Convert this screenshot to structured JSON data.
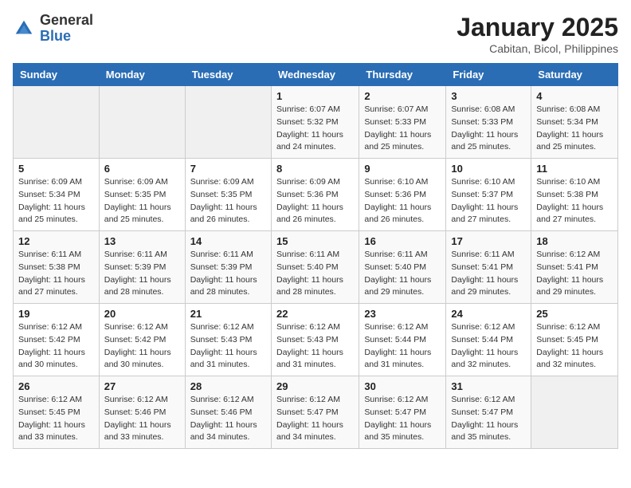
{
  "logo": {
    "general": "General",
    "blue": "Blue"
  },
  "title": "January 2025",
  "subtitle": "Cabitan, Bicol, Philippines",
  "days_of_week": [
    "Sunday",
    "Monday",
    "Tuesday",
    "Wednesday",
    "Thursday",
    "Friday",
    "Saturday"
  ],
  "weeks": [
    [
      {
        "day": "",
        "info": ""
      },
      {
        "day": "",
        "info": ""
      },
      {
        "day": "",
        "info": ""
      },
      {
        "day": "1",
        "info": "Sunrise: 6:07 AM\nSunset: 5:32 PM\nDaylight: 11 hours\nand 24 minutes."
      },
      {
        "day": "2",
        "info": "Sunrise: 6:07 AM\nSunset: 5:33 PM\nDaylight: 11 hours\nand 25 minutes."
      },
      {
        "day": "3",
        "info": "Sunrise: 6:08 AM\nSunset: 5:33 PM\nDaylight: 11 hours\nand 25 minutes."
      },
      {
        "day": "4",
        "info": "Sunrise: 6:08 AM\nSunset: 5:34 PM\nDaylight: 11 hours\nand 25 minutes."
      }
    ],
    [
      {
        "day": "5",
        "info": "Sunrise: 6:09 AM\nSunset: 5:34 PM\nDaylight: 11 hours\nand 25 minutes."
      },
      {
        "day": "6",
        "info": "Sunrise: 6:09 AM\nSunset: 5:35 PM\nDaylight: 11 hours\nand 25 minutes."
      },
      {
        "day": "7",
        "info": "Sunrise: 6:09 AM\nSunset: 5:35 PM\nDaylight: 11 hours\nand 26 minutes."
      },
      {
        "day": "8",
        "info": "Sunrise: 6:09 AM\nSunset: 5:36 PM\nDaylight: 11 hours\nand 26 minutes."
      },
      {
        "day": "9",
        "info": "Sunrise: 6:10 AM\nSunset: 5:36 PM\nDaylight: 11 hours\nand 26 minutes."
      },
      {
        "day": "10",
        "info": "Sunrise: 6:10 AM\nSunset: 5:37 PM\nDaylight: 11 hours\nand 27 minutes."
      },
      {
        "day": "11",
        "info": "Sunrise: 6:10 AM\nSunset: 5:38 PM\nDaylight: 11 hours\nand 27 minutes."
      }
    ],
    [
      {
        "day": "12",
        "info": "Sunrise: 6:11 AM\nSunset: 5:38 PM\nDaylight: 11 hours\nand 27 minutes."
      },
      {
        "day": "13",
        "info": "Sunrise: 6:11 AM\nSunset: 5:39 PM\nDaylight: 11 hours\nand 28 minutes."
      },
      {
        "day": "14",
        "info": "Sunrise: 6:11 AM\nSunset: 5:39 PM\nDaylight: 11 hours\nand 28 minutes."
      },
      {
        "day": "15",
        "info": "Sunrise: 6:11 AM\nSunset: 5:40 PM\nDaylight: 11 hours\nand 28 minutes."
      },
      {
        "day": "16",
        "info": "Sunrise: 6:11 AM\nSunset: 5:40 PM\nDaylight: 11 hours\nand 29 minutes."
      },
      {
        "day": "17",
        "info": "Sunrise: 6:11 AM\nSunset: 5:41 PM\nDaylight: 11 hours\nand 29 minutes."
      },
      {
        "day": "18",
        "info": "Sunrise: 6:12 AM\nSunset: 5:41 PM\nDaylight: 11 hours\nand 29 minutes."
      }
    ],
    [
      {
        "day": "19",
        "info": "Sunrise: 6:12 AM\nSunset: 5:42 PM\nDaylight: 11 hours\nand 30 minutes."
      },
      {
        "day": "20",
        "info": "Sunrise: 6:12 AM\nSunset: 5:42 PM\nDaylight: 11 hours\nand 30 minutes."
      },
      {
        "day": "21",
        "info": "Sunrise: 6:12 AM\nSunset: 5:43 PM\nDaylight: 11 hours\nand 31 minutes."
      },
      {
        "day": "22",
        "info": "Sunrise: 6:12 AM\nSunset: 5:43 PM\nDaylight: 11 hours\nand 31 minutes."
      },
      {
        "day": "23",
        "info": "Sunrise: 6:12 AM\nSunset: 5:44 PM\nDaylight: 11 hours\nand 31 minutes."
      },
      {
        "day": "24",
        "info": "Sunrise: 6:12 AM\nSunset: 5:44 PM\nDaylight: 11 hours\nand 32 minutes."
      },
      {
        "day": "25",
        "info": "Sunrise: 6:12 AM\nSunset: 5:45 PM\nDaylight: 11 hours\nand 32 minutes."
      }
    ],
    [
      {
        "day": "26",
        "info": "Sunrise: 6:12 AM\nSunset: 5:45 PM\nDaylight: 11 hours\nand 33 minutes."
      },
      {
        "day": "27",
        "info": "Sunrise: 6:12 AM\nSunset: 5:46 PM\nDaylight: 11 hours\nand 33 minutes."
      },
      {
        "day": "28",
        "info": "Sunrise: 6:12 AM\nSunset: 5:46 PM\nDaylight: 11 hours\nand 34 minutes."
      },
      {
        "day": "29",
        "info": "Sunrise: 6:12 AM\nSunset: 5:47 PM\nDaylight: 11 hours\nand 34 minutes."
      },
      {
        "day": "30",
        "info": "Sunrise: 6:12 AM\nSunset: 5:47 PM\nDaylight: 11 hours\nand 35 minutes."
      },
      {
        "day": "31",
        "info": "Sunrise: 6:12 AM\nSunset: 5:47 PM\nDaylight: 11 hours\nand 35 minutes."
      },
      {
        "day": "",
        "info": ""
      }
    ]
  ]
}
